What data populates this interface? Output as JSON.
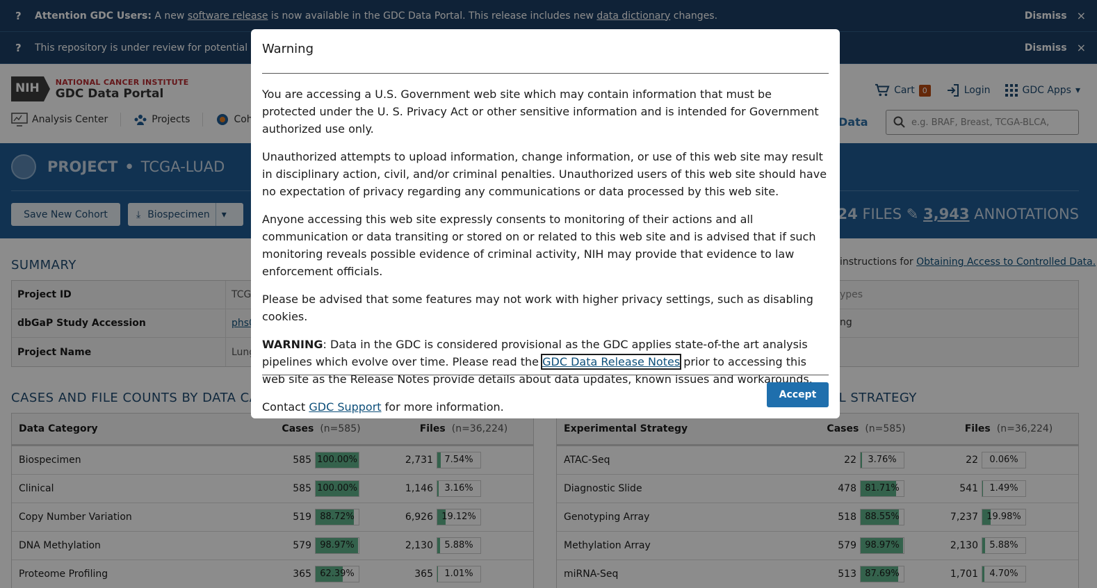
{
  "banners": [
    {
      "icon": "?",
      "strong": "Attention GDC Users:",
      "pre": " A new ",
      "link1": "software release",
      "mid": " is now available in the GDC Data Portal. This release includes new ",
      "link2": "data dictionary",
      "post": " changes.",
      "dismiss": "Dismiss",
      "close": "×"
    },
    {
      "icon": "?",
      "text": "This repository is under review for potential modification in compliance with Administration directives.",
      "dismiss": "Dismiss",
      "close": "×"
    }
  ],
  "header": {
    "nih": "NIH",
    "institute": "NATIONAL CANCER INSTITUTE",
    "portal": "GDC Data Portal",
    "cart_label": "Cart",
    "cart_count": "0",
    "login": "Login",
    "apps": "GDC Apps",
    "nav": [
      "Analysis Center",
      "Projects",
      "Cohort Builder"
    ],
    "nav_data": "Data",
    "search_placeholder": "e.g. BRAF, Breast, TCGA-BLCA,"
  },
  "project": {
    "label": "PROJECT",
    "dot": "•",
    "id": "TCGA-LUAD",
    "save_btn": "Save New Cohort",
    "bio_btn": "Biospecimen",
    "files_num": "36,224",
    "files_label": "FILES",
    "ann_num": "3,943",
    "ann_label": "ANNOTATIONS"
  },
  "summary": {
    "title": "SUMMARY",
    "rows": [
      {
        "k": "Project ID",
        "v": "TCGA-LUAD"
      },
      {
        "k": "dbGaP Study Accession",
        "v": "phs000178"
      },
      {
        "k": "Project Name",
        "v": "Lung Adenocarcinoma"
      }
    ],
    "right_pre": "instructions for ",
    "right_link": "Obtaining Access to Controlled Data.",
    "frag1": "ypes",
    "frag2": "ng"
  },
  "data_category": {
    "title": "CASES AND FILE COUNTS BY DATA CATEGORY",
    "h1": "Data Category",
    "h2": "Cases",
    "h2n": "(n=585)",
    "h3": "Files",
    "h3n": "(n=36,224)",
    "rows": [
      {
        "name": "Biospecimen",
        "cases": "585",
        "cpct": "100.00%",
        "cfrac": 1.0,
        "files": "2,731",
        "fpct": "7.54%",
        "ffrac": 0.0754
      },
      {
        "name": "Clinical",
        "cases": "585",
        "cpct": "100.00%",
        "cfrac": 1.0,
        "files": "1,146",
        "fpct": "3.16%",
        "ffrac": 0.0316
      },
      {
        "name": "Copy Number Variation",
        "cases": "519",
        "cpct": "88.72%",
        "cfrac": 0.8872,
        "files": "6,926",
        "fpct": "19.12%",
        "ffrac": 0.1912
      },
      {
        "name": "DNA Methylation",
        "cases": "579",
        "cpct": "98.97%",
        "cfrac": 0.9897,
        "files": "2,130",
        "fpct": "5.88%",
        "ffrac": 0.0588
      },
      {
        "name": "Proteome Profiling",
        "cases": "365",
        "cpct": "62.39%",
        "cfrac": 0.6239,
        "files": "365",
        "fpct": "1.01%",
        "ffrac": 0.0101
      }
    ]
  },
  "exp_strategy": {
    "title": "CASES AND FILE COUNTS BY EXPERIMENTAL STRATEGY",
    "h1": "Experimental Strategy",
    "h2": "Cases",
    "h2n": "(n=585)",
    "h3": "Files",
    "h3n": "(n=36,224)",
    "rows": [
      {
        "name": "ATAC-Seq",
        "cases": "22",
        "cpct": "3.76%",
        "cfrac": 0.0376,
        "files": "22",
        "fpct": "0.06%",
        "ffrac": 0.0006
      },
      {
        "name": "Diagnostic Slide",
        "cases": "478",
        "cpct": "81.71%",
        "cfrac": 0.8171,
        "files": "541",
        "fpct": "1.49%",
        "ffrac": 0.0149
      },
      {
        "name": "Genotyping Array",
        "cases": "518",
        "cpct": "88.55%",
        "cfrac": 0.8855,
        "files": "7,237",
        "fpct": "19.98%",
        "ffrac": 0.1998
      },
      {
        "name": "Methylation Array",
        "cases": "579",
        "cpct": "98.97%",
        "cfrac": 0.9897,
        "files": "2,130",
        "fpct": "5.88%",
        "ffrac": 0.0588
      },
      {
        "name": "miRNA-Seq",
        "cases": "513",
        "cpct": "87.69%",
        "cfrac": 0.8769,
        "files": "1,701",
        "fpct": "4.70%",
        "ffrac": 0.047
      }
    ]
  },
  "modal": {
    "title": "Warning",
    "p1": "You are accessing a U.S. Government web site which may contain information that must be protected under the U. S. Privacy Act or other sensitive information and is intended for Government authorized use only.",
    "p2": "Unauthorized attempts to upload information, change information, or use of this web site may result in disciplinary action, civil, and/or criminal penalties. Unauthorized users of this web site should have no expectation of privacy regarding any communications or data processed by this web site.",
    "p3": "Anyone accessing this web site expressly consents to monitoring of their actions and all communication or data transiting or stored on or related to this web site and is advised that if such monitoring reveals possible evidence of criminal activity, NIH may provide that evidence to law enforcement officials.",
    "p4": "Please be advised that some features may not work with higher privacy settings, such as disabling cookies.",
    "p5_strong": "WARNING",
    "p5_a": ": Data in the GDC is considered provisional as the GDC applies state-of-the art analysis pipelines which evolve over time. Please read the ",
    "p5_link": "GDC Data Release Notes",
    "p5_b": " prior to accessing this web site as the Release Notes provide details about data updates, known issues and workarounds.",
    "p6_a": "Contact ",
    "p6_link": "GDC Support",
    "p6_b": " for more information.",
    "accept": "Accept"
  }
}
